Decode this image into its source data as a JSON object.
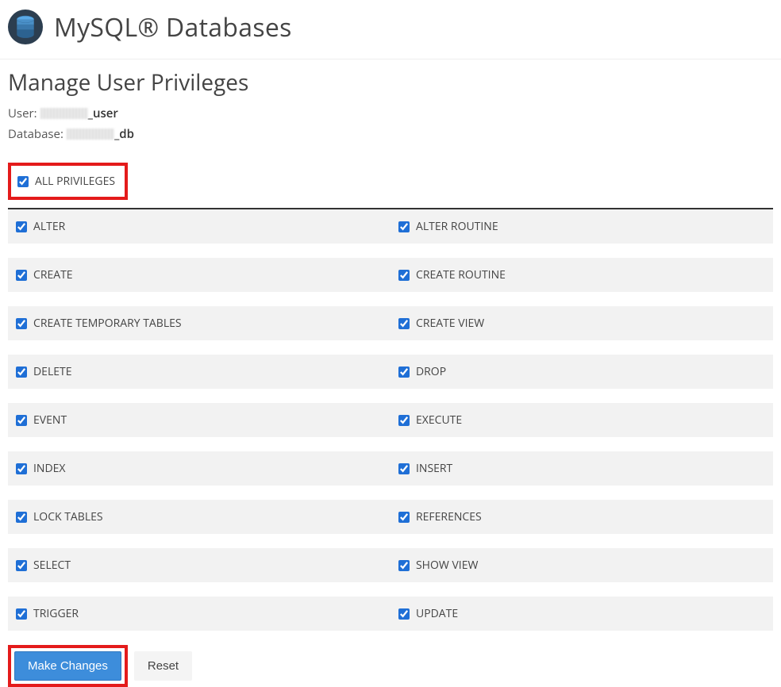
{
  "header": {
    "title": "MySQL® Databases"
  },
  "section": {
    "title": "Manage User Privileges",
    "user_label": "User:",
    "user_suffix": "_user",
    "database_label": "Database:",
    "database_suffix": "_db"
  },
  "all_privileges": {
    "label": "ALL PRIVILEGES",
    "checked": true
  },
  "privileges": [
    {
      "left": {
        "label": "ALTER",
        "checked": true
      },
      "right": {
        "label": "ALTER ROUTINE",
        "checked": true
      }
    },
    {
      "left": {
        "label": "CREATE",
        "checked": true
      },
      "right": {
        "label": "CREATE ROUTINE",
        "checked": true
      }
    },
    {
      "left": {
        "label": "CREATE TEMPORARY TABLES",
        "checked": true
      },
      "right": {
        "label": "CREATE VIEW",
        "checked": true
      }
    },
    {
      "left": {
        "label": "DELETE",
        "checked": true
      },
      "right": {
        "label": "DROP",
        "checked": true
      }
    },
    {
      "left": {
        "label": "EVENT",
        "checked": true
      },
      "right": {
        "label": "EXECUTE",
        "checked": true
      }
    },
    {
      "left": {
        "label": "INDEX",
        "checked": true
      },
      "right": {
        "label": "INSERT",
        "checked": true
      }
    },
    {
      "left": {
        "label": "LOCK TABLES",
        "checked": true
      },
      "right": {
        "label": "REFERENCES",
        "checked": true
      }
    },
    {
      "left": {
        "label": "SELECT",
        "checked": true
      },
      "right": {
        "label": "SHOW VIEW",
        "checked": true
      }
    },
    {
      "left": {
        "label": "TRIGGER",
        "checked": true
      },
      "right": {
        "label": "UPDATE",
        "checked": true
      }
    }
  ],
  "actions": {
    "make_changes": "Make Changes",
    "reset": "Reset"
  }
}
